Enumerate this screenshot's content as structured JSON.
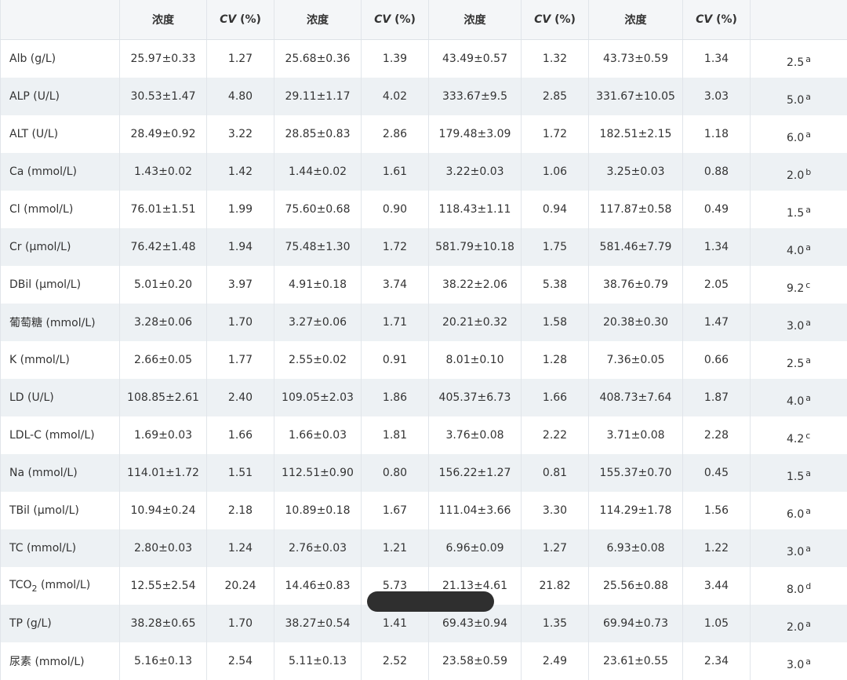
{
  "header": {
    "col_conc": "浓度",
    "col_cv_italic": "CV",
    "col_cv_unit": " (%)"
  },
  "rows": [
    {
      "analyte": "Alb (g/L)",
      "sub": "",
      "unit": "",
      "v": [
        "25.97±0.33",
        "1.27",
        "25.68±0.36",
        "1.39",
        "43.49±0.57",
        "1.32",
        "43.73±0.59",
        "1.34"
      ],
      "ref": "2.5",
      "ref_note": "a"
    },
    {
      "analyte": "ALP (U/L)",
      "sub": "",
      "unit": "",
      "v": [
        "30.53±1.47",
        "4.80",
        "29.11±1.17",
        "4.02",
        "333.67±9.5",
        "2.85",
        "331.67±10.05",
        "3.03"
      ],
      "ref": "5.0",
      "ref_note": "a"
    },
    {
      "analyte": "ALT (U/L)",
      "sub": "",
      "unit": "",
      "v": [
        "28.49±0.92",
        "3.22",
        "28.85±0.83",
        "2.86",
        "179.48±3.09",
        "1.72",
        "182.51±2.15",
        "1.18"
      ],
      "ref": "6.0",
      "ref_note": "a"
    },
    {
      "analyte": "Ca (mmol/L)",
      "sub": "",
      "unit": "",
      "v": [
        "1.43±0.02",
        "1.42",
        "1.44±0.02",
        "1.61",
        "3.22±0.03",
        "1.06",
        "3.25±0.03",
        "0.88"
      ],
      "ref": "2.0",
      "ref_note": "b"
    },
    {
      "analyte": "Cl (mmol/L)",
      "sub": "",
      "unit": "",
      "v": [
        "76.01±1.51",
        "1.99",
        "75.60±0.68",
        "0.90",
        "118.43±1.11",
        "0.94",
        "117.87±0.58",
        "0.49"
      ],
      "ref": "1.5",
      "ref_note": "a"
    },
    {
      "analyte": "Cr (μmol/L)",
      "sub": "",
      "unit": "",
      "v": [
        "76.42±1.48",
        "1.94",
        "75.48±1.30",
        "1.72",
        "581.79±10.18",
        "1.75",
        "581.46±7.79",
        "1.34"
      ],
      "ref": "4.0",
      "ref_note": "a"
    },
    {
      "analyte": "DBil (μmol/L)",
      "sub": "",
      "unit": "",
      "v": [
        "5.01±0.20",
        "3.97",
        "4.91±0.18",
        "3.74",
        "38.22±2.06",
        "5.38",
        "38.76±0.79",
        "2.05"
      ],
      "ref": "9.2",
      "ref_note": "c"
    },
    {
      "analyte": "葡萄糖 (mmol/L)",
      "sub": "",
      "unit": "",
      "v": [
        "3.28±0.06",
        "1.70",
        "3.27±0.06",
        "1.71",
        "20.21±0.32",
        "1.58",
        "20.38±0.30",
        "1.47"
      ],
      "ref": "3.0",
      "ref_note": "a"
    },
    {
      "analyte": "K (mmol/L)",
      "sub": "",
      "unit": "",
      "v": [
        "2.66±0.05",
        "1.77",
        "2.55±0.02",
        "0.91",
        "8.01±0.10",
        "1.28",
        "7.36±0.05",
        "0.66"
      ],
      "ref": "2.5",
      "ref_note": "a"
    },
    {
      "analyte": "LD (U/L)",
      "sub": "",
      "unit": "",
      "v": [
        "108.85±2.61",
        "2.40",
        "109.05±2.03",
        "1.86",
        "405.37±6.73",
        "1.66",
        "408.73±7.64",
        "1.87"
      ],
      "ref": "4.0",
      "ref_note": "a"
    },
    {
      "analyte": "LDL-C (mmol/L)",
      "sub": "",
      "unit": "",
      "v": [
        "1.69±0.03",
        "1.66",
        "1.66±0.03",
        "1.81",
        "3.76±0.08",
        "2.22",
        "3.71±0.08",
        "2.28"
      ],
      "ref": "4.2",
      "ref_note": "c"
    },
    {
      "analyte": "Na (mmol/L)",
      "sub": "",
      "unit": "",
      "v": [
        "114.01±1.72",
        "1.51",
        "112.51±0.90",
        "0.80",
        "156.22±1.27",
        "0.81",
        "155.37±0.70",
        "0.45"
      ],
      "ref": "1.5",
      "ref_note": "a"
    },
    {
      "analyte": "TBil (μmol/L)",
      "sub": "",
      "unit": "",
      "v": [
        "10.94±0.24",
        "2.18",
        "10.89±0.18",
        "1.67",
        "111.04±3.66",
        "3.30",
        "114.29±1.78",
        "1.56"
      ],
      "ref": "6.0",
      "ref_note": "a"
    },
    {
      "analyte": "TC (mmol/L)",
      "sub": "",
      "unit": "",
      "v": [
        "2.80±0.03",
        "1.24",
        "2.76±0.03",
        "1.21",
        "6.96±0.09",
        "1.27",
        "6.93±0.08",
        "1.22"
      ],
      "ref": "3.0",
      "ref_note": "a"
    },
    {
      "analyte": "TCO",
      "sub": "2",
      "unit": " (mmol/L)",
      "v": [
        "12.55±2.54",
        "20.24",
        "14.46±0.83",
        "5.73",
        "21.13±4.61",
        "21.82",
        "25.56±0.88",
        "3.44"
      ],
      "ref": "8.0",
      "ref_note": "d"
    },
    {
      "analyte": "TP (g/L)",
      "sub": "",
      "unit": "",
      "v": [
        "38.28±0.65",
        "1.70",
        "38.27±0.54",
        "1.41",
        "69.43±0.94",
        "1.35",
        "69.94±0.73",
        "1.05"
      ],
      "ref": "2.0",
      "ref_note": "a"
    },
    {
      "analyte": "尿素 (mmol/L)",
      "sub": "",
      "unit": "",
      "v": [
        "5.16±0.13",
        "2.54",
        "5.11±0.13",
        "2.52",
        "23.58±0.59",
        "2.49",
        "23.61±0.55",
        "2.34"
      ],
      "ref": "3.0",
      "ref_note": "a"
    }
  ]
}
